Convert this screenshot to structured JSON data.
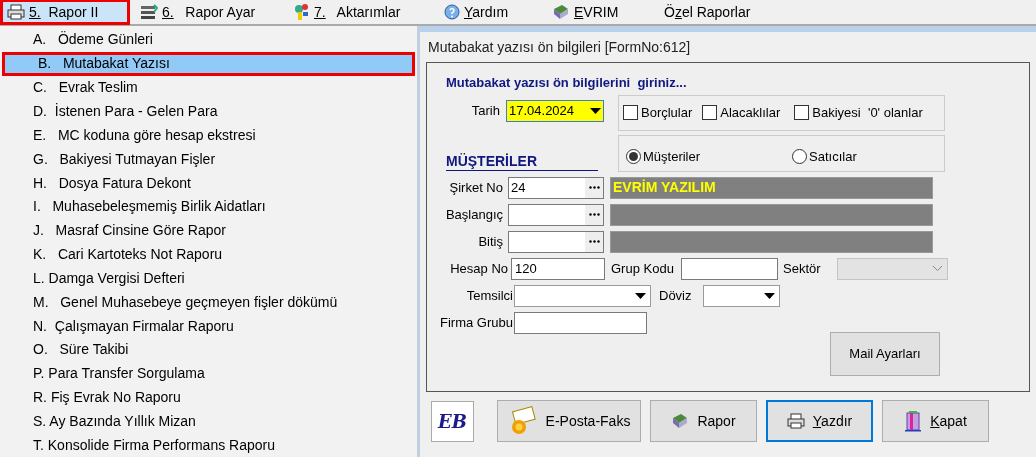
{
  "menu_bar": [
    {
      "key": "5.",
      "post": "  Rapor II",
      "kind": "printer",
      "selected": true,
      "highlighted": true
    },
    {
      "key": "6.",
      "post": "   Rapor Ayar",
      "kind": "papers",
      "selected": false,
      "highlighted": false
    },
    {
      "key": "7.",
      "post": "   Aktarımlar",
      "kind": "tools",
      "selected": false,
      "highlighted": false
    },
    {
      "key": "Y",
      "post": "ardım",
      "kind": "help",
      "selected": false,
      "highlighted": false
    },
    {
      "key": "E",
      "post": "VRIM",
      "kind": "book",
      "selected": false,
      "highlighted": false
    },
    {
      "pre": "Ö",
      "key": "z",
      "post": "el Raporlar",
      "selected": false,
      "highlighted": false
    }
  ],
  "dropdown": [
    {
      "text": "A.   Ödeme Günleri",
      "selected": false,
      "highlighted": false
    },
    {
      "text": "B.   Mutabakat Yazısı",
      "selected": true,
      "highlighted": true
    },
    {
      "text": "C.   Evrak Teslim",
      "selected": false,
      "highlighted": false
    },
    {
      "text": "D.  İstenen Para - Gelen Para",
      "selected": false,
      "highlighted": false
    },
    {
      "text": "E.   MC koduna göre hesap ekstresi",
      "selected": false,
      "highlighted": false
    },
    {
      "text": "G.   Bakiyesi Tutmayan Fişler",
      "selected": false,
      "highlighted": false
    },
    {
      "text": "H.   Dosya Fatura Dekont",
      "selected": false,
      "highlighted": false
    },
    {
      "text": "I.   Muhasebeleşmemiş Birlik Aidatları",
      "selected": false,
      "highlighted": false
    },
    {
      "text": "J.   Masraf Cinsine Göre Rapor",
      "selected": false,
      "highlighted": false
    },
    {
      "text": "K.   Cari Kartoteks Not Raporu",
      "selected": false,
      "highlighted": false
    },
    {
      "text": "L. Damga Vergisi Defteri",
      "selected": false,
      "highlighted": false
    },
    {
      "text": "M.   Genel Muhasebeye geçmeyen fişler dökümü",
      "selected": false,
      "highlighted": false
    },
    {
      "text": "N.  Çalışmayan Firmalar Raporu",
      "selected": false,
      "highlighted": false
    },
    {
      "text": "O.   Süre Takibi",
      "selected": false,
      "highlighted": false
    },
    {
      "text": "P. Para Transfer Sorgulama",
      "selected": false,
      "highlighted": false
    },
    {
      "text": "R. Fiş Evrak No Raporu",
      "selected": false,
      "highlighted": false
    },
    {
      "text": "S. Ay Bazında Yıllık Mizan",
      "selected": false,
      "highlighted": false
    },
    {
      "text": "T. Konsolide Firma Performans Raporu",
      "selected": false,
      "highlighted": false
    }
  ],
  "form": {
    "title": "Mutabakat yazısı ön bilgileri [FormNo:612]",
    "heading": "Mutabakat yazısı ön bilgilerini  giriniz...",
    "date": {
      "label": "Tarih",
      "value": "17.04.2024"
    },
    "checkboxes": [
      {
        "label": "Borçlular",
        "checked": false
      },
      {
        "label": "Alacaklılar",
        "checked": false
      },
      {
        "label": "Bakiyesi  '0' olanlar",
        "checked": false
      }
    ],
    "radios": [
      {
        "label": "Müşteriler",
        "selected": true
      },
      {
        "label": "Satıcılar",
        "selected": false
      }
    ],
    "section": "MÜŞTERİLER",
    "lookups": [
      {
        "label": "Şirket No",
        "value": "24",
        "name": "EVRİM YAZILIM"
      },
      {
        "label": "Başlangıç"
      },
      {
        "label": "Bitiş"
      }
    ],
    "hesap_no": {
      "label": "Hesap No",
      "value": "120"
    },
    "grup_kodu": {
      "label": "Grup Kodu"
    },
    "sektor": {
      "label": "Sektör",
      "disabled": true
    },
    "temsilci": {
      "label": "Temsilci"
    },
    "doviz": {
      "label": "Döviz"
    },
    "firma_grubu": {
      "label": "Firma Grubu"
    },
    "mail_button": "Mail Ayarları"
  },
  "toolbar": {
    "logo": "EB",
    "buttons": [
      {
        "post": "E-Posta-Faks",
        "kind": "mail",
        "focused": false
      },
      {
        "post": "Rapor",
        "kind": "book",
        "focused": false
      },
      {
        "key": "Y",
        "post": "azdır",
        "kind": "printer",
        "focused": true
      },
      {
        "key": "K",
        "post": "apat",
        "kind": "door",
        "focused": false
      }
    ]
  }
}
